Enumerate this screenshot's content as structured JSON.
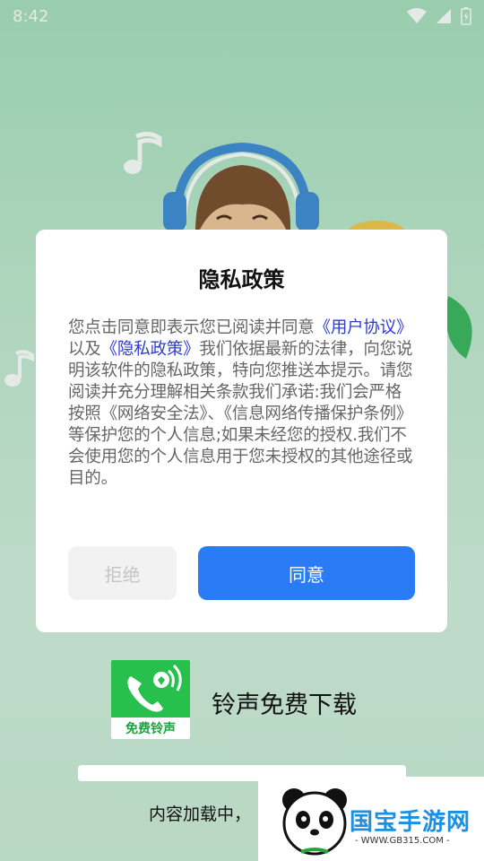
{
  "status_bar": {
    "time": "8:42"
  },
  "dialog": {
    "title": "隐私政策",
    "body_parts": {
      "intro": "您点击同意即表示您已阅读并同意",
      "user_agreement_link": "《用户协议》",
      "and": "以及",
      "privacy_policy_link": "《隐私政策》",
      "rest": "我们依据最新的法律，向您说明该软件的隐私政策，特向您推送本提示。请您阅读并充分理解相关条款我们承诺:我们会严格按照《网络安全法》、《信息网络传播保护条例》等保护您的个人信息;如果未经您的授权.我们不会使用您的个人信息用于您未授权的其他途径或目的。"
    },
    "reject_label": "拒绝",
    "agree_label": "同意"
  },
  "app": {
    "logo_text": "免费铃声",
    "name": "铃声免费下载"
  },
  "loading": {
    "text": "内容加载中，"
  },
  "watermark": {
    "title": "国宝手游网",
    "url": "- WWW.GB315.COM -"
  },
  "colors": {
    "background": "#bfe6cd",
    "agree_button": "#2a7cf6",
    "link": "#2f3bd6",
    "app_logo": "#27c04d",
    "watermark_title": "#1b8fe0"
  },
  "icons": {
    "status": [
      "wifi-icon",
      "signal-icon",
      "battery-icon"
    ],
    "decor": [
      "music-note-icon",
      "headphone-boy-illustration",
      "panda-logo-icon",
      "phone-icon"
    ]
  }
}
